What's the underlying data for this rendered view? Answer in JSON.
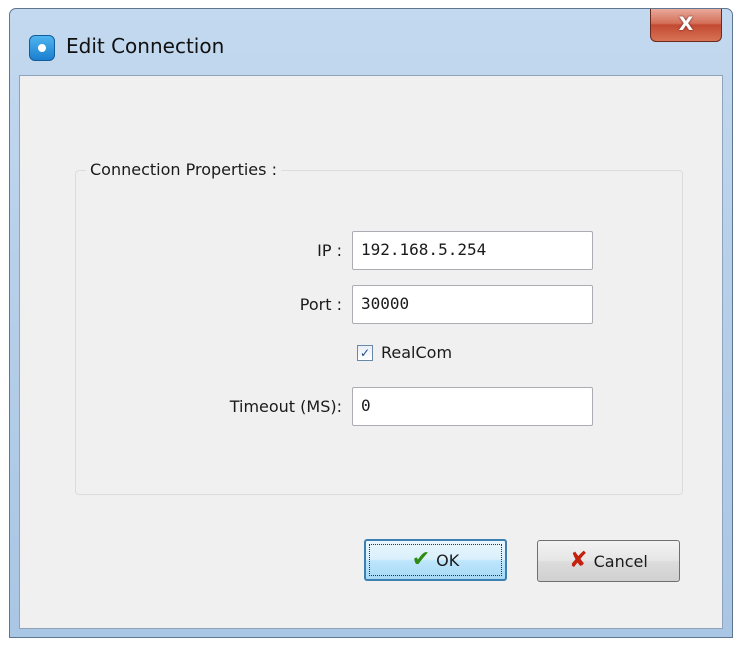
{
  "window": {
    "title": "Edit Connection",
    "close_symbol": "X"
  },
  "group": {
    "title": "Connection Properties :"
  },
  "fields": {
    "ip_label": "IP :",
    "ip_value": "192.168.5.254",
    "port_label": "Port :",
    "port_value": "30000",
    "realcom_label": "RealCom",
    "realcom_checked": true,
    "timeout_label": "Timeout (MS):",
    "timeout_value": "0"
  },
  "buttons": {
    "ok_label": "OK",
    "cancel_label": "Cancel"
  },
  "icons": {
    "app": "app-icon",
    "close": "close-icon",
    "ok": "checkmark-icon",
    "cancel": "x-icon"
  },
  "colors": {
    "ok_icon": "#2f8b12",
    "cancel_icon": "#c3200e",
    "close_button": "#c24a32"
  }
}
